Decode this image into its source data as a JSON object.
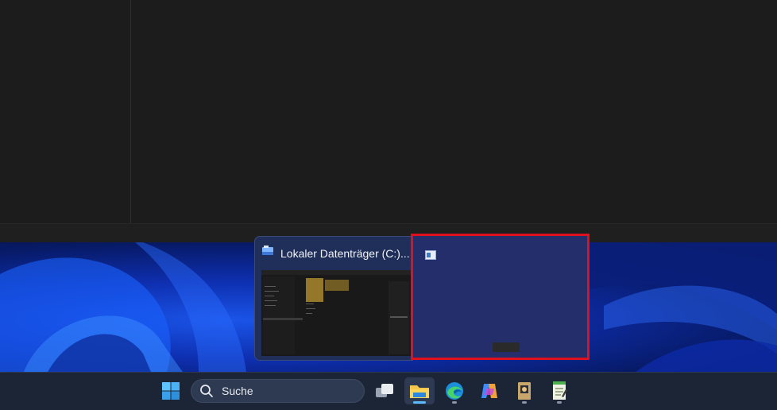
{
  "taskbar": {
    "search_label": "Suche",
    "items": [
      "start",
      "search",
      "task-view",
      "file-explorer",
      "edge",
      "copilot",
      "app-1",
      "notepad"
    ]
  },
  "thumbnail_1": {
    "title": "Lokaler Datenträger (C:)..."
  },
  "colors": {
    "highlight": "#e0101c",
    "active_indicator": "#5cb8ff"
  }
}
